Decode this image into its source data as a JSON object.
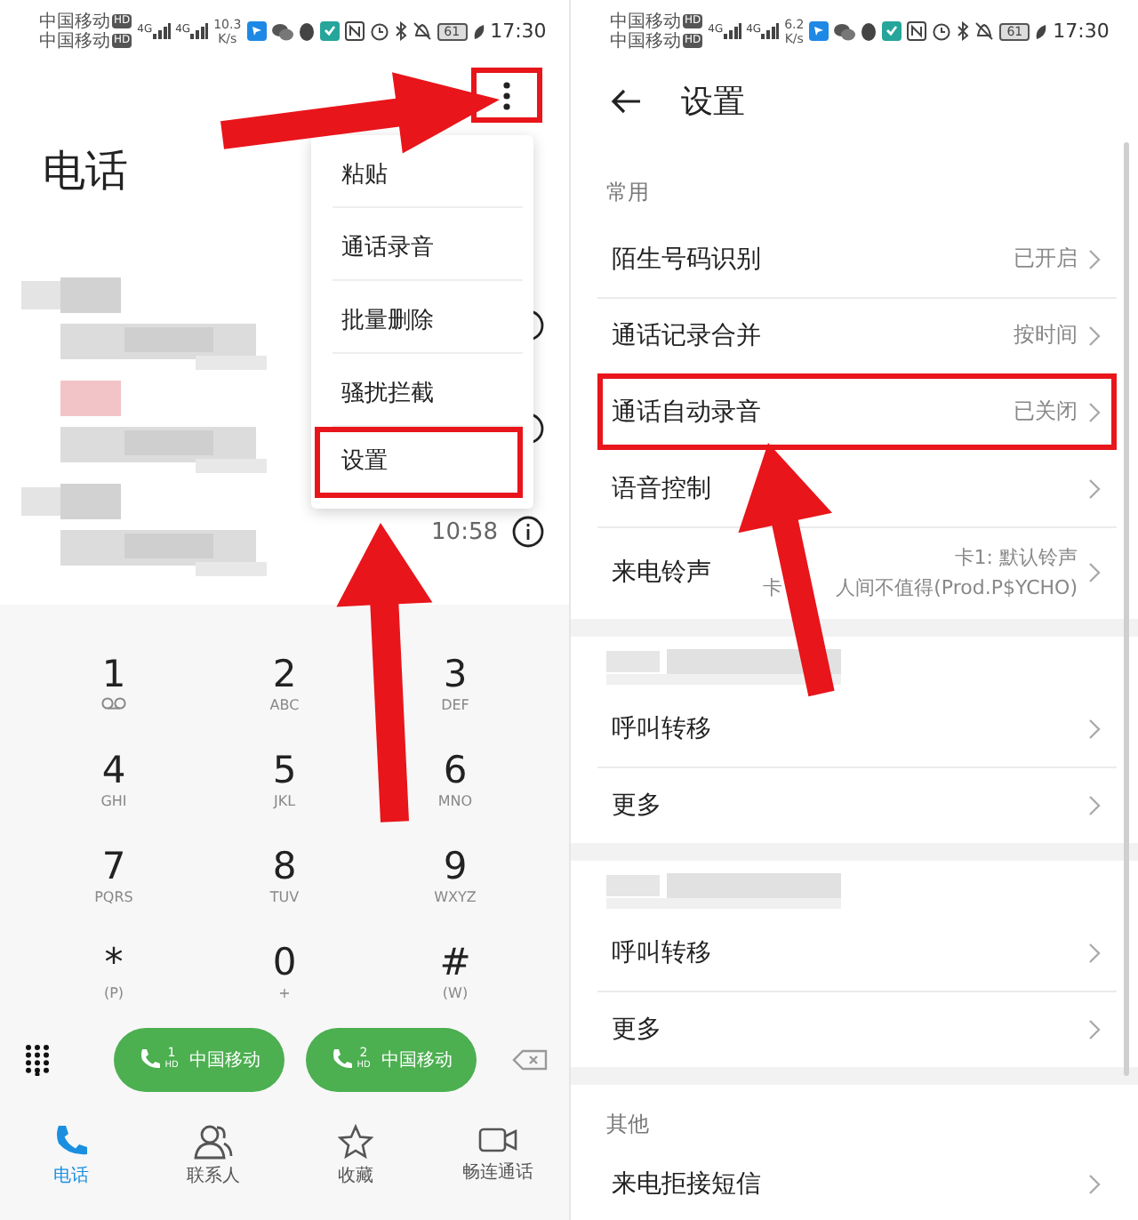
{
  "phone": {
    "status_bar": {
      "carriers": [
        {
          "name": "中国移动",
          "badge": "HD"
        },
        {
          "name": "中国移动",
          "badge": "HD"
        }
      ],
      "networks": [
        "4G",
        "4G"
      ],
      "speed": {
        "value": "10.3",
        "unit": "K/s"
      },
      "battery": "61",
      "time": "17:30"
    },
    "menu_button": {
      "highlighted": true
    },
    "title": "电话",
    "menu": [
      {
        "label": "粘贴",
        "highlighted": false
      },
      {
        "label": "通话录音",
        "highlighted": false
      },
      {
        "label": "批量删除",
        "highlighted": false
      },
      {
        "label": "骚扰拦截",
        "highlighted": false
      },
      {
        "label": "设置",
        "highlighted": true
      }
    ],
    "call_log": [
      {
        "missed": false
      },
      {
        "missed": true
      },
      {
        "missed": false,
        "time": "10:58"
      }
    ],
    "keys": [
      {
        "kind": "voicemail",
        "digit": "1"
      },
      {
        "kind": "letters",
        "digit": "2",
        "letters": "ABC"
      },
      {
        "kind": "letters",
        "digit": "3",
        "letters": "DEF"
      },
      {
        "kind": "letters",
        "digit": "4",
        "letters": "GHI"
      },
      {
        "kind": "letters",
        "digit": "5",
        "letters": "JKL"
      },
      {
        "kind": "letters",
        "digit": "6",
        "letters": "MNO"
      },
      {
        "kind": "letters",
        "digit": "7",
        "letters": "PQRS"
      },
      {
        "kind": "letters",
        "digit": "8",
        "letters": "TUV"
      },
      {
        "kind": "letters",
        "digit": "9",
        "letters": "WXYZ"
      },
      {
        "kind": "letters",
        "digit": "*",
        "letters": "(P)"
      },
      {
        "kind": "letters",
        "digit": "0",
        "letters": "+"
      },
      {
        "kind": "letters",
        "digit": "#",
        "letters": "(W)"
      }
    ],
    "call_buttons": [
      {
        "sim": "1",
        "badge": "HD",
        "label": "中国移动"
      },
      {
        "sim": "2",
        "badge": "HD",
        "label": "中国移动"
      }
    ],
    "nav": [
      {
        "kind": "phone",
        "label": "电话",
        "selected": true
      },
      {
        "kind": "contacts",
        "label": "联系人",
        "selected": false
      },
      {
        "kind": "star",
        "label": "收藏",
        "selected": false
      },
      {
        "kind": "video",
        "label": "畅连通话",
        "selected": false
      }
    ]
  },
  "settings": {
    "status_bar": {
      "carriers": [
        {
          "name": "中国移动",
          "badge": "HD"
        },
        {
          "name": "中国移动",
          "badge": "HD"
        }
      ],
      "networks": [
        "4G",
        "4G"
      ],
      "speed": {
        "value": "6.2",
        "unit": "K/s"
      },
      "battery": "61",
      "time": "17:30"
    },
    "title": "设置",
    "sections": [
      {
        "kind": "label",
        "label": "常用",
        "rows": [
          {
            "label": "陌生号码识别",
            "value": "已开启",
            "highlighted": false
          },
          {
            "label": "通话记录合并",
            "value": "按时间",
            "highlighted": false
          },
          {
            "label": "通话自动录音",
            "value": "已关闭",
            "highlighted": true
          },
          {
            "label": "语音控制",
            "highlighted": false
          },
          {
            "label": "来电铃声",
            "value_lines": [
              [
                "卡1: 默认铃声"
              ],
              [
                "卡",
                "人间不值得(Prod.P$YCHO)"
              ]
            ],
            "highlighted": false
          }
        ]
      },
      {
        "kind": "redacted",
        "rows": [
          {
            "label": "呼叫转移",
            "highlighted": false
          },
          {
            "label": "更多",
            "highlighted": false
          }
        ]
      },
      {
        "kind": "redacted",
        "rows": [
          {
            "label": "呼叫转移",
            "highlighted": false
          },
          {
            "label": "更多",
            "highlighted": false
          }
        ]
      },
      {
        "kind": "label",
        "label": "其他",
        "rows": [
          {
            "label": "来电拒接短信",
            "highlighted": false
          }
        ]
      }
    ]
  }
}
